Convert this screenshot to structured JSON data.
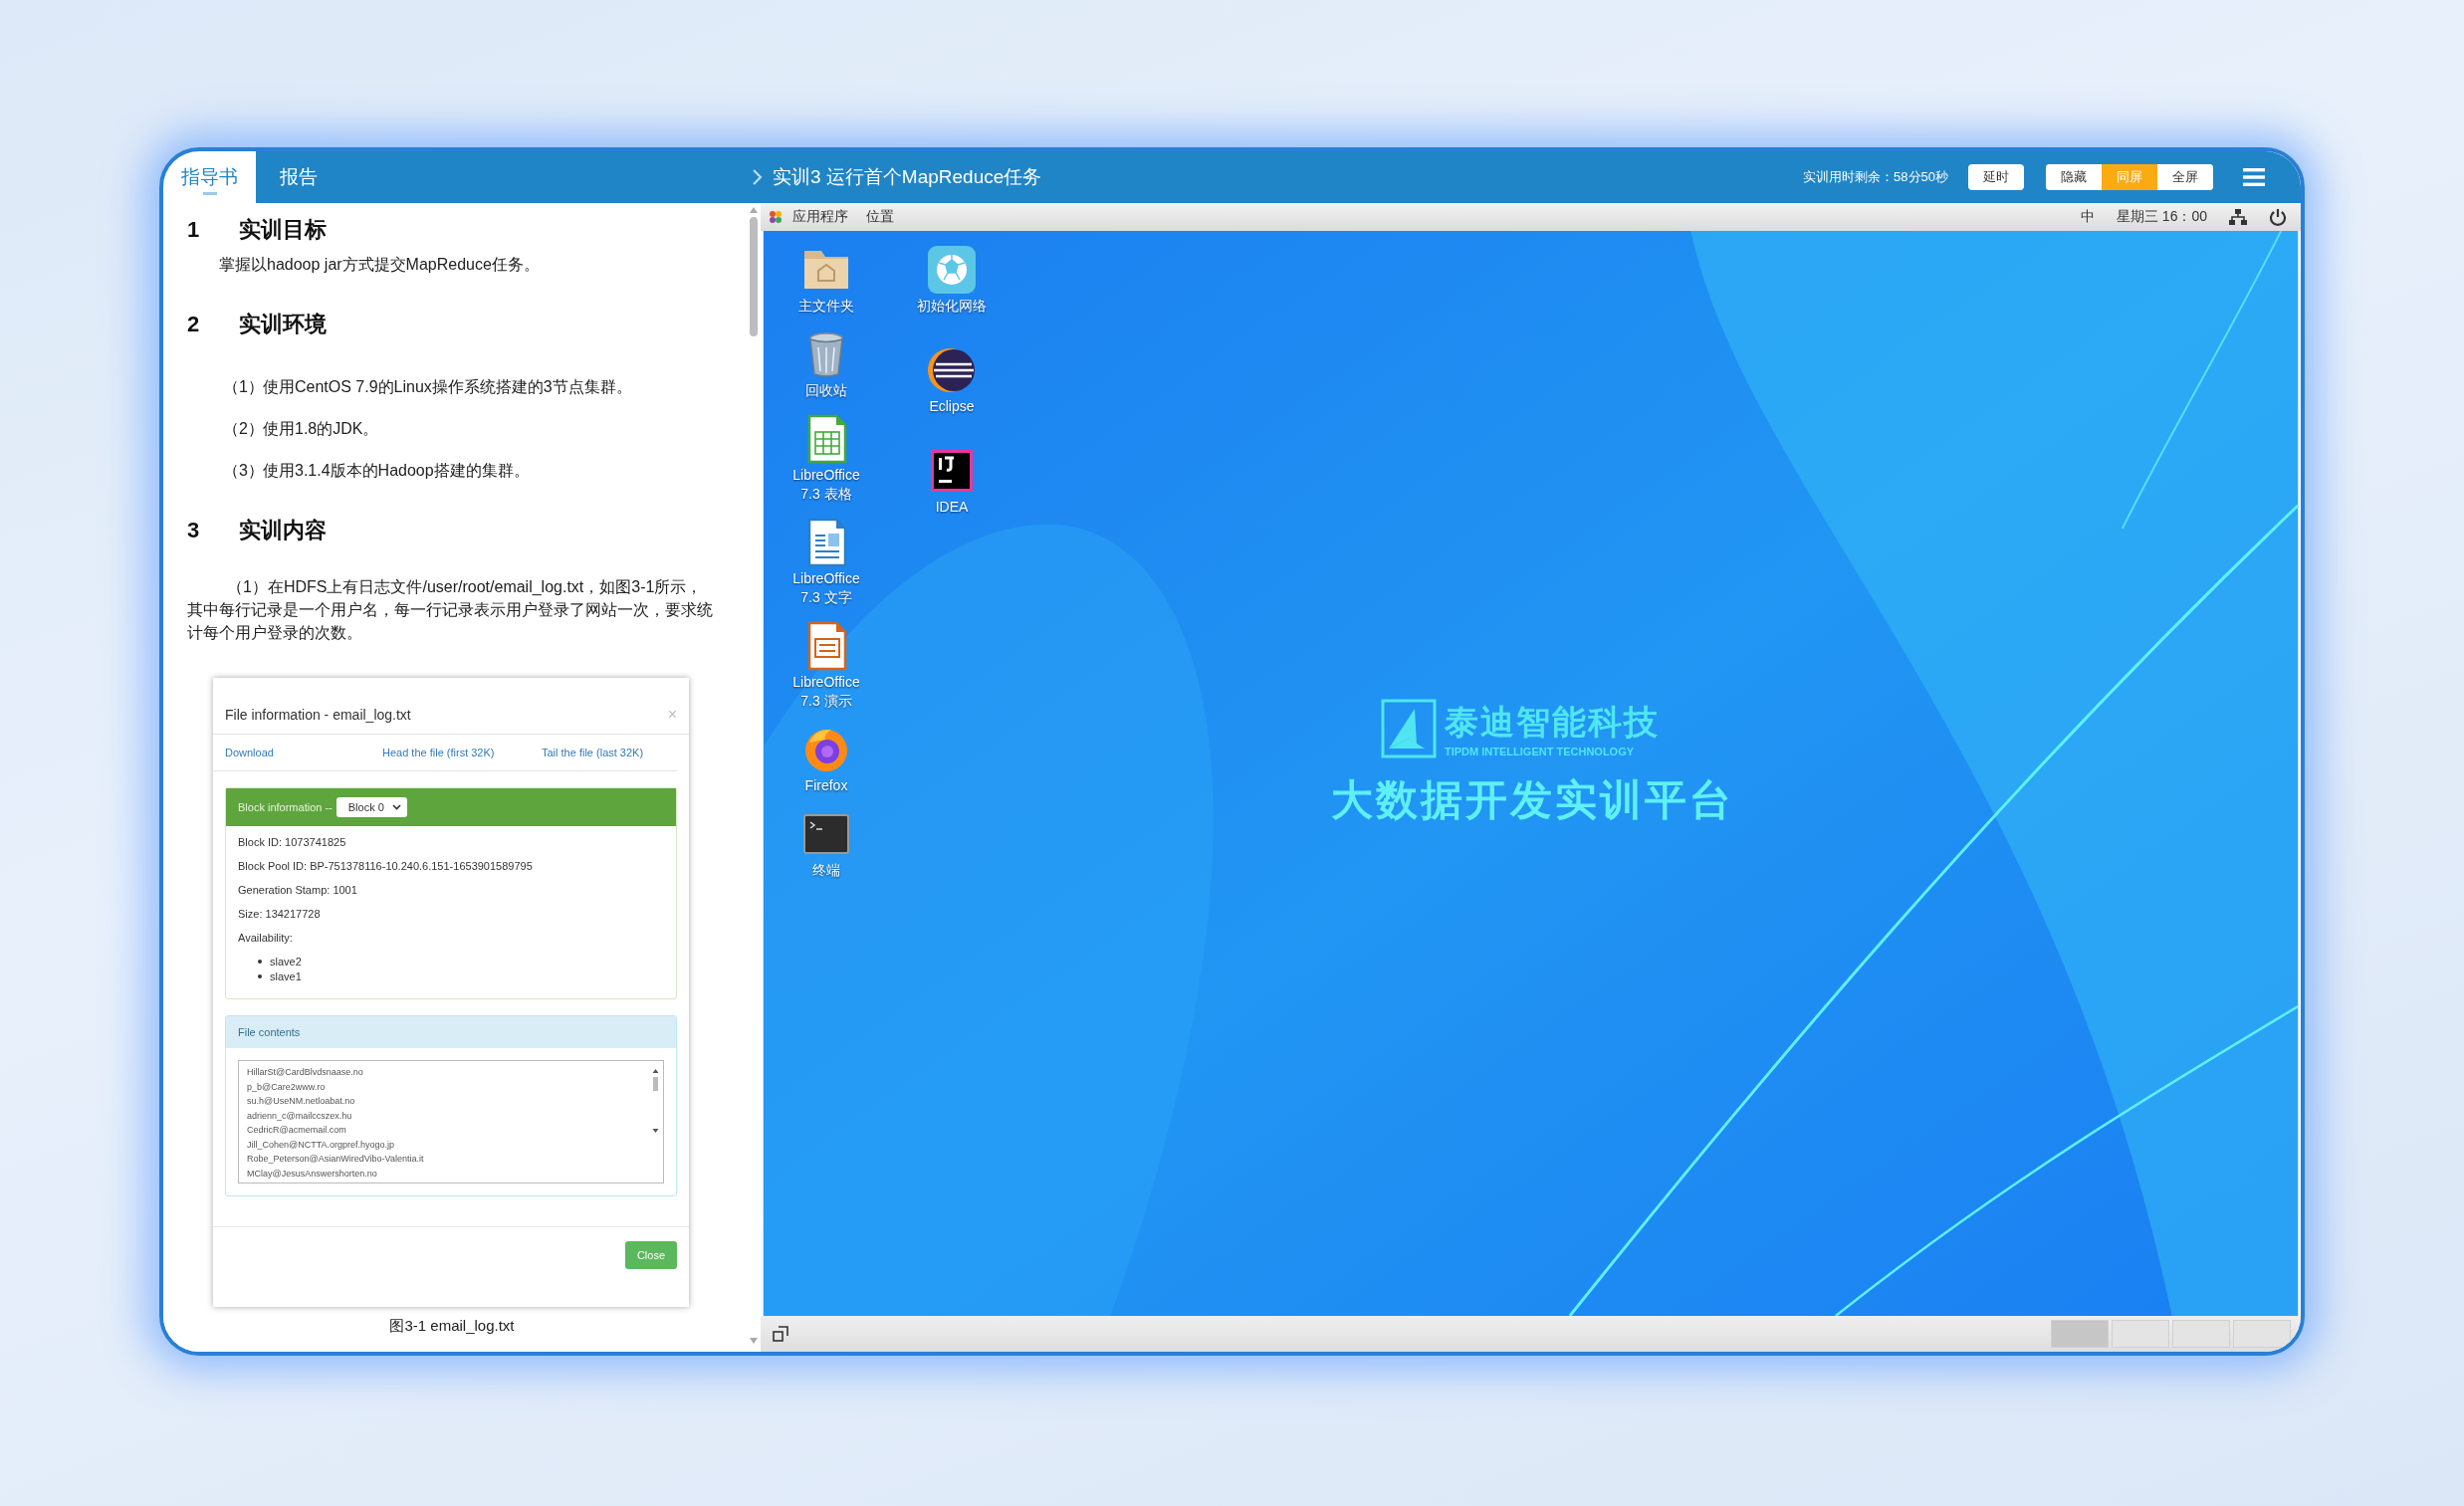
{
  "tabs": [
    {
      "label": "指导书",
      "selected": true
    },
    {
      "label": "报告",
      "selected": false
    }
  ],
  "title_bar": {
    "title": "实训3 运行首个MapReduce任务",
    "timer": "实训用时剩余：58分50秒",
    "extend_button": "延时",
    "view_modes": [
      {
        "label": "隐藏",
        "selected": false
      },
      {
        "label": "同屏",
        "selected": true
      },
      {
        "label": "全屏",
        "selected": false
      }
    ]
  },
  "document": {
    "sections": [
      {
        "number": "1",
        "heading": "实训目标",
        "blocks": [
          {
            "kind": "paragraph",
            "text": "掌握以hadoop jar方式提交MapReduce任务。"
          }
        ]
      },
      {
        "number": "2",
        "heading": "实训环境",
        "blocks": [
          {
            "kind": "list_item",
            "marker": "（1）",
            "text": "使用CentOS 7.9的Linux操作系统搭建的3节点集群。"
          },
          {
            "kind": "list_item",
            "marker": "（2）",
            "text": "使用1.8的JDK。"
          },
          {
            "kind": "list_item",
            "marker": "（3）",
            "text": "使用3.1.4版本的Hadoop搭建的集群。"
          }
        ]
      },
      {
        "number": "3",
        "heading": "实训内容",
        "blocks": [
          {
            "kind": "numbered_paragraph",
            "marker": "（1）",
            "text": "在HDFS上有日志文件/user/root/email_log.txt，如图3-1所示，其中每行记录是一个用户名，每一行记录表示用户登录了网站一次，要求统计每个用户登录的次数。"
          }
        ]
      }
    ],
    "figure": {
      "dialog": {
        "title": "File information - email_log.txt",
        "close": "×",
        "links": [
          "Download",
          "Head the file (first 32K)",
          "Tail the file (last 32K)"
        ],
        "block_panel": {
          "label": "Block information --",
          "select": "Block 0",
          "lines": [
            "Block ID: 1073741825",
            "Block Pool ID: BP-751378116-10.240.6.151-1653901589795",
            "Generation Stamp: 1001",
            "Size: 134217728",
            "Availability:"
          ],
          "nodes": [
            "slave2",
            "slave1"
          ]
        },
        "contents_panel": {
          "heading": "File contents",
          "lines": [
            "HillarSt@CardBlvdsnaase.no",
            "p_b@Care2www.ro",
            "su.h@UseNM.netloabat.no",
            "adrienn_c@mailccszex.hu",
            "CedricR@acmemail.com",
            "Jill_Cohen@NCTTA.orgpref.hyogo.jp",
            "Robe_Peterson@AsianWiredVibo-Valentia.it",
            "MClay@JesusAnswershorten.no"
          ]
        },
        "close_button": "Close"
      },
      "caption": "图3-1 email_log.txt"
    }
  },
  "desktop": {
    "top_panel": {
      "menus": [
        "应用程序",
        "位置"
      ],
      "input_method": "中",
      "clock": "星期三 16：00"
    },
    "icon_columns": [
      [
        {
          "label": "主文件夹",
          "kind": "home"
        },
        {
          "label": "回收站",
          "kind": "trash"
        },
        {
          "label": "LibreOffice 7.3 表格",
          "kind": "calc"
        },
        {
          "label": "LibreOffice 7.3 文字",
          "kind": "writer"
        },
        {
          "label": "LibreOffice 7.3 演示",
          "kind": "impress"
        },
        {
          "label": "Firefox",
          "kind": "firefox"
        },
        {
          "label": "终端",
          "kind": "terminal"
        }
      ],
      [
        {
          "label": "初始化网络",
          "kind": "network"
        },
        {
          "label": "Eclipse",
          "kind": "eclipse"
        },
        {
          "label": "IDEA",
          "kind": "idea"
        }
      ]
    ],
    "brand": {
      "name": "泰迪智能科技",
      "tagline": "TIPDM INTELLIGENT TECHNOLOGY",
      "platform": "大数据开发实训平台"
    },
    "workspaces": [
      {
        "selected": true
      },
      {
        "selected": false
      },
      {
        "selected": false
      },
      {
        "selected": false
      }
    ]
  }
}
